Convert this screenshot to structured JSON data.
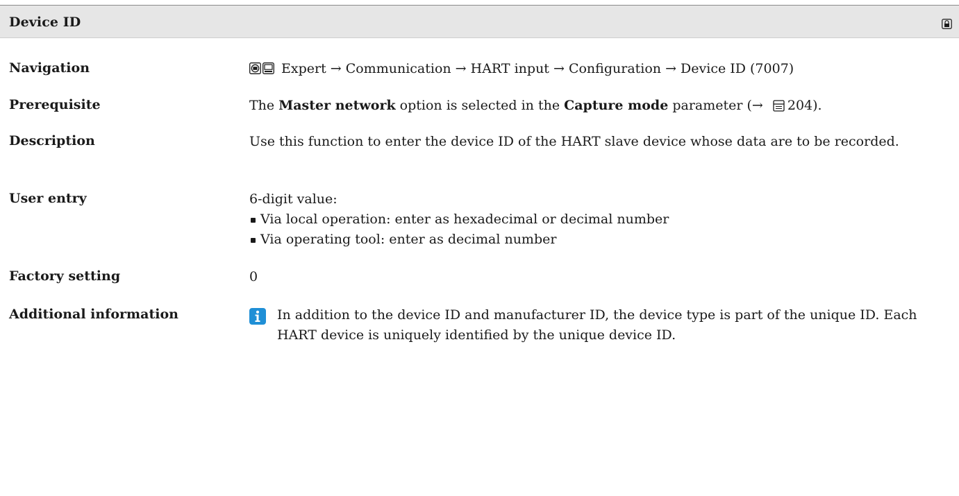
{
  "header": {
    "title": "Device ID",
    "lock_icon": "lock-icon"
  },
  "navigation": {
    "label": "Navigation",
    "icons": [
      "display-icon",
      "menu-icon"
    ],
    "path": "Expert → Communication → HART input → Configuration → Device ID (7007)"
  },
  "prerequisite": {
    "label": "Prerequisite",
    "text1": "The ",
    "bold1": "Master network",
    "text2": " option is selected in the ",
    "bold2": "Capture mode",
    "text3": " parameter (→ ",
    "page_ref": "204",
    "text4": ")."
  },
  "description": {
    "label": "Description",
    "text": "Use this function to enter the device ID of the HART slave device whose data are to be recorded."
  },
  "user_entry": {
    "label": "User entry",
    "intro": "6-digit value:",
    "items": [
      "Via local operation: enter as hexadecimal or decimal number",
      "Via operating tool: enter as decimal number"
    ]
  },
  "factory_setting": {
    "label": "Factory setting",
    "value": "0"
  },
  "additional_information": {
    "label": "Additional information",
    "icon": "info-icon",
    "text": "In addition to the device ID and manufacturer ID, the device type is part of the unique ID. Each HART device is uniquely identified by the unique device ID."
  },
  "colors": {
    "header_bg": "#e6e6e6",
    "info_icon": "#1f8fd6"
  }
}
